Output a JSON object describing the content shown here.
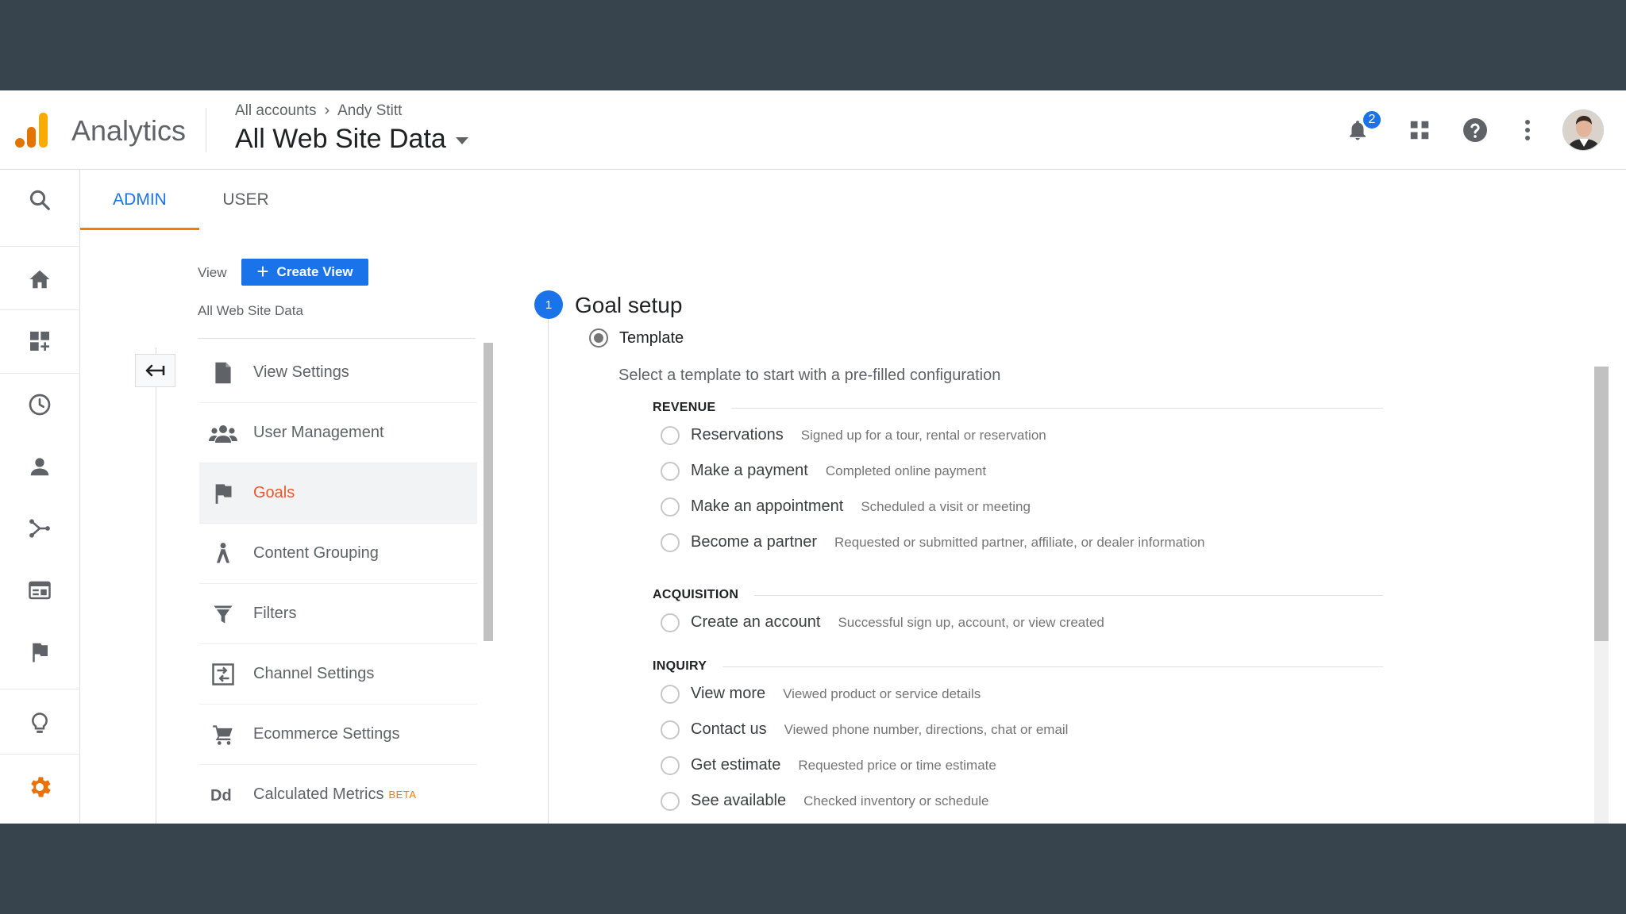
{
  "header": {
    "brand": "Analytics",
    "breadcrumb": {
      "account": "All accounts",
      "separator": "›",
      "property": "Andy Stitt"
    },
    "view_selector": "All Web Site Data",
    "notification_count": "2"
  },
  "tabs": {
    "admin": "ADMIN",
    "user": "USER"
  },
  "view_column": {
    "label": "View",
    "create_button": "Create View",
    "view_name": "All Web Site Data",
    "items": [
      {
        "label": "View Settings",
        "icon": "document-icon"
      },
      {
        "label": "User Management",
        "icon": "people-icon"
      },
      {
        "label": "Goals",
        "icon": "flag-icon",
        "active": true
      },
      {
        "label": "Content Grouping",
        "icon": "grouping-icon"
      },
      {
        "label": "Filters",
        "icon": "filter-icon"
      },
      {
        "label": "Channel Settings",
        "icon": "channel-icon"
      },
      {
        "label": "Ecommerce Settings",
        "icon": "cart-icon"
      },
      {
        "label": "Calculated Metrics",
        "icon": "calculated-icon",
        "badge": "BETA"
      }
    ]
  },
  "goal_setup": {
    "step": "1",
    "title": "Goal setup",
    "template_label": "Template",
    "template_desc": "Select a template to start with a pre-filled configuration",
    "sections": [
      {
        "title": "REVENUE",
        "options": [
          {
            "label": "Reservations",
            "desc": "Signed up for a tour, rental or reservation"
          },
          {
            "label": "Make a payment",
            "desc": "Completed online payment"
          },
          {
            "label": "Make an appointment",
            "desc": "Scheduled a visit or meeting"
          },
          {
            "label": "Become a partner",
            "desc": "Requested or submitted partner, affiliate, or dealer information"
          }
        ]
      },
      {
        "title": "ACQUISITION",
        "options": [
          {
            "label": "Create an account",
            "desc": "Successful sign up, account, or view created"
          }
        ]
      },
      {
        "title": "INQUIRY",
        "options": [
          {
            "label": "View more",
            "desc": "Viewed product or service details"
          },
          {
            "label": "Contact us",
            "desc": "Viewed phone number, directions, chat or email"
          },
          {
            "label": "Get estimate",
            "desc": "Requested price or time estimate"
          },
          {
            "label": "See available",
            "desc": "Checked inventory or schedule"
          }
        ]
      }
    ]
  },
  "colors": {
    "accent": "#1a73e8",
    "active": "#e8592a",
    "tab_underline": "#f57c00",
    "frame": "#37444e"
  }
}
